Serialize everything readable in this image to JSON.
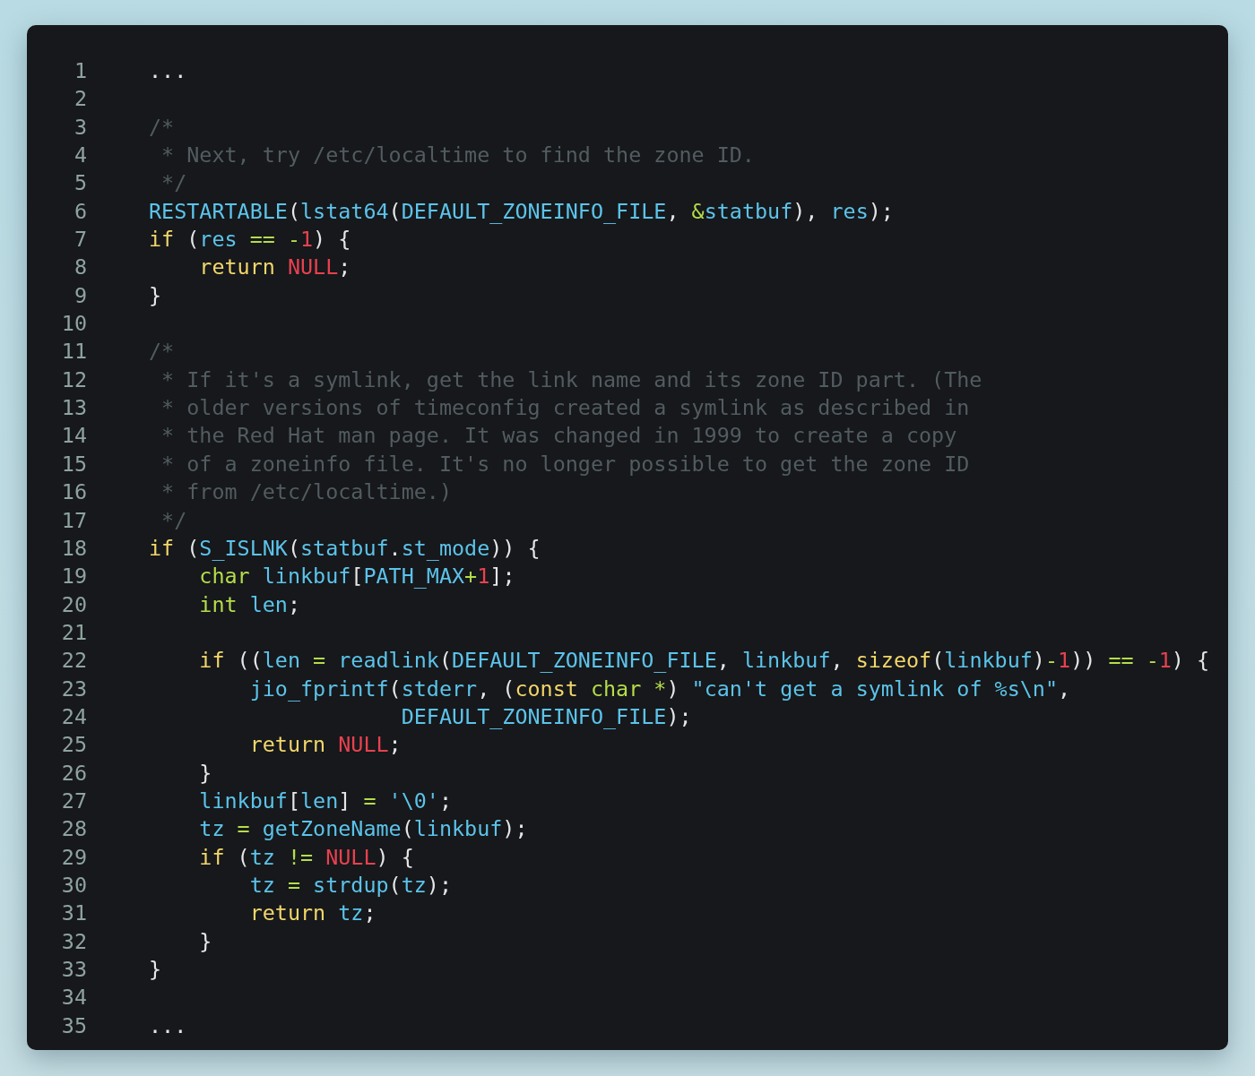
{
  "code_lines": [
    {
      "number": "1",
      "tokens": [
        {
          "kind": "pl",
          "text": "..."
        }
      ]
    },
    {
      "number": "2"
    },
    {
      "number": "3",
      "tokens": [
        {
          "kind": "cmt",
          "text": "/*"
        }
      ]
    },
    {
      "number": "4",
      "tokens": [
        {
          "kind": "cmt",
          "text": " * Next, try /etc/localtime to find the zone ID."
        }
      ]
    },
    {
      "number": "5",
      "tokens": [
        {
          "kind": "cmt",
          "text": " */"
        }
      ]
    },
    {
      "number": "6",
      "tokens": [
        {
          "kind": "id",
          "text": "RESTARTABLE"
        },
        {
          "kind": "pl",
          "text": "("
        },
        {
          "kind": "id",
          "text": "lstat64"
        },
        {
          "kind": "pl",
          "text": "("
        },
        {
          "kind": "id",
          "text": "DEFAULT_ZONEINFO_FILE"
        },
        {
          "kind": "pl",
          "text": ", "
        },
        {
          "kind": "op",
          "text": "&"
        },
        {
          "kind": "id",
          "text": "statbuf"
        },
        {
          "kind": "pl",
          "text": "), "
        },
        {
          "kind": "id",
          "text": "res"
        },
        {
          "kind": "pl",
          "text": ");"
        }
      ]
    },
    {
      "number": "7",
      "tokens": [
        {
          "kind": "kw",
          "text": "if"
        },
        {
          "kind": "pl",
          "text": " ("
        },
        {
          "kind": "id",
          "text": "res"
        },
        {
          "kind": "op",
          "text": " =="
        },
        {
          "kind": "op",
          "text": " -"
        },
        {
          "kind": "num",
          "text": "1"
        },
        {
          "kind": "pl",
          "text": ") {"
        }
      ]
    },
    {
      "number": "8",
      "tokens": [
        {
          "kind": "kw",
          "text": "    return"
        },
        {
          "kind": "num",
          "text": " NULL"
        },
        {
          "kind": "pl",
          "text": ";"
        }
      ]
    },
    {
      "number": "9",
      "tokens": [
        {
          "kind": "pl",
          "text": "}"
        }
      ]
    },
    {
      "number": "10"
    },
    {
      "number": "11",
      "tokens": [
        {
          "kind": "cmt",
          "text": "/*"
        }
      ]
    },
    {
      "number": "12",
      "tokens": [
        {
          "kind": "cmt",
          "text": " * If it's a symlink, get the link name and its zone ID part. (The"
        }
      ]
    },
    {
      "number": "13",
      "tokens": [
        {
          "kind": "cmt",
          "text": " * older versions of timeconfig created a symlink as described in"
        }
      ]
    },
    {
      "number": "14",
      "tokens": [
        {
          "kind": "cmt",
          "text": " * the Red Hat man page. It was changed in 1999 to create a copy"
        }
      ]
    },
    {
      "number": "15",
      "tokens": [
        {
          "kind": "cmt",
          "text": " * of a zoneinfo file. It's no longer possible to get the zone ID"
        }
      ]
    },
    {
      "number": "16",
      "tokens": [
        {
          "kind": "cmt",
          "text": " * from /etc/localtime.)"
        }
      ]
    },
    {
      "number": "17",
      "tokens": [
        {
          "kind": "cmt",
          "text": " */"
        }
      ]
    },
    {
      "number": "18",
      "tokens": [
        {
          "kind": "kw",
          "text": "if"
        },
        {
          "kind": "pl",
          "text": " ("
        },
        {
          "kind": "id",
          "text": "S_ISLNK"
        },
        {
          "kind": "pl",
          "text": "("
        },
        {
          "kind": "id",
          "text": "statbuf"
        },
        {
          "kind": "pl",
          "text": "."
        },
        {
          "kind": "id",
          "text": "st_mode"
        },
        {
          "kind": "pl",
          "text": ")) {"
        }
      ]
    },
    {
      "number": "19",
      "tokens": [
        {
          "kind": "type",
          "text": "    char"
        },
        {
          "kind": "id",
          "text": " linkbuf"
        },
        {
          "kind": "pl",
          "text": "["
        },
        {
          "kind": "id",
          "text": "PATH_MAX"
        },
        {
          "kind": "op",
          "text": "+"
        },
        {
          "kind": "num",
          "text": "1"
        },
        {
          "kind": "pl",
          "text": "];"
        }
      ]
    },
    {
      "number": "20",
      "tokens": [
        {
          "kind": "type",
          "text": "    int"
        },
        {
          "kind": "id",
          "text": " len"
        },
        {
          "kind": "pl",
          "text": ";"
        }
      ]
    },
    {
      "number": "21"
    },
    {
      "number": "22",
      "tokens": [
        {
          "kind": "kw",
          "text": "    if"
        },
        {
          "kind": "pl",
          "text": " (("
        },
        {
          "kind": "id",
          "text": "len"
        },
        {
          "kind": "op",
          "text": " ="
        },
        {
          "kind": "id",
          "text": " readlink"
        },
        {
          "kind": "pl",
          "text": "("
        },
        {
          "kind": "id",
          "text": "DEFAULT_ZONEINFO_FILE"
        },
        {
          "kind": "pl",
          "text": ", "
        },
        {
          "kind": "id",
          "text": "linkbuf"
        },
        {
          "kind": "pl",
          "text": ", "
        },
        {
          "kind": "kw",
          "text": "sizeof"
        },
        {
          "kind": "pl",
          "text": "("
        },
        {
          "kind": "id",
          "text": "linkbuf"
        },
        {
          "kind": "pl",
          "text": ")"
        },
        {
          "kind": "op",
          "text": "-"
        },
        {
          "kind": "num",
          "text": "1"
        },
        {
          "kind": "pl",
          "text": ")) "
        },
        {
          "kind": "op",
          "text": "=="
        },
        {
          "kind": "op",
          "text": " -"
        },
        {
          "kind": "num",
          "text": "1"
        },
        {
          "kind": "pl",
          "text": ") {"
        }
      ]
    },
    {
      "number": "23",
      "tokens": [
        {
          "kind": "id",
          "text": "        jio_fprintf"
        },
        {
          "kind": "pl",
          "text": "("
        },
        {
          "kind": "id",
          "text": "stderr"
        },
        {
          "kind": "pl",
          "text": ", ("
        },
        {
          "kind": "kw",
          "text": "const"
        },
        {
          "kind": "type",
          "text": " char"
        },
        {
          "kind": "op",
          "text": " *"
        },
        {
          "kind": "pl",
          "text": ") "
        },
        {
          "kind": "str",
          "text": "\"can't get a symlink of %s\\n\""
        },
        {
          "kind": "pl",
          "text": ","
        }
      ]
    },
    {
      "number": "24",
      "tokens": [
        {
          "kind": "id",
          "text": "                    DEFAULT_ZONEINFO_FILE"
        },
        {
          "kind": "pl",
          "text": ");"
        }
      ]
    },
    {
      "number": "25",
      "tokens": [
        {
          "kind": "kw",
          "text": "        return"
        },
        {
          "kind": "num",
          "text": " NULL"
        },
        {
          "kind": "pl",
          "text": ";"
        }
      ]
    },
    {
      "number": "26",
      "tokens": [
        {
          "kind": "pl",
          "text": "    }"
        }
      ]
    },
    {
      "number": "27",
      "tokens": [
        {
          "kind": "id",
          "text": "    linkbuf"
        },
        {
          "kind": "pl",
          "text": "["
        },
        {
          "kind": "id",
          "text": "len"
        },
        {
          "kind": "pl",
          "text": "] "
        },
        {
          "kind": "op",
          "text": "="
        },
        {
          "kind": "str",
          "text": " '\\0'"
        },
        {
          "kind": "pl",
          "text": ";"
        }
      ]
    },
    {
      "number": "28",
      "tokens": [
        {
          "kind": "id",
          "text": "    tz"
        },
        {
          "kind": "op",
          "text": " ="
        },
        {
          "kind": "id",
          "text": " getZoneName"
        },
        {
          "kind": "pl",
          "text": "("
        },
        {
          "kind": "id",
          "text": "linkbuf"
        },
        {
          "kind": "pl",
          "text": ");"
        }
      ]
    },
    {
      "number": "29",
      "tokens": [
        {
          "kind": "kw",
          "text": "    if"
        },
        {
          "kind": "pl",
          "text": " ("
        },
        {
          "kind": "id",
          "text": "tz"
        },
        {
          "kind": "op",
          "text": " !="
        },
        {
          "kind": "num",
          "text": " NULL"
        },
        {
          "kind": "pl",
          "text": ") {"
        }
      ]
    },
    {
      "number": "30",
      "tokens": [
        {
          "kind": "id",
          "text": "        tz"
        },
        {
          "kind": "op",
          "text": " ="
        },
        {
          "kind": "id",
          "text": " strdup"
        },
        {
          "kind": "pl",
          "text": "("
        },
        {
          "kind": "id",
          "text": "tz"
        },
        {
          "kind": "pl",
          "text": ");"
        }
      ]
    },
    {
      "number": "31",
      "tokens": [
        {
          "kind": "kw",
          "text": "        return"
        },
        {
          "kind": "id",
          "text": " tz"
        },
        {
          "kind": "pl",
          "text": ";"
        }
      ]
    },
    {
      "number": "32",
      "tokens": [
        {
          "kind": "pl",
          "text": "    }"
        }
      ]
    },
    {
      "number": "33",
      "tokens": [
        {
          "kind": "pl",
          "text": "}"
        }
      ]
    },
    {
      "number": "34"
    },
    {
      "number": "35",
      "tokens": [
        {
          "kind": "pl",
          "text": "..."
        }
      ]
    }
  ]
}
